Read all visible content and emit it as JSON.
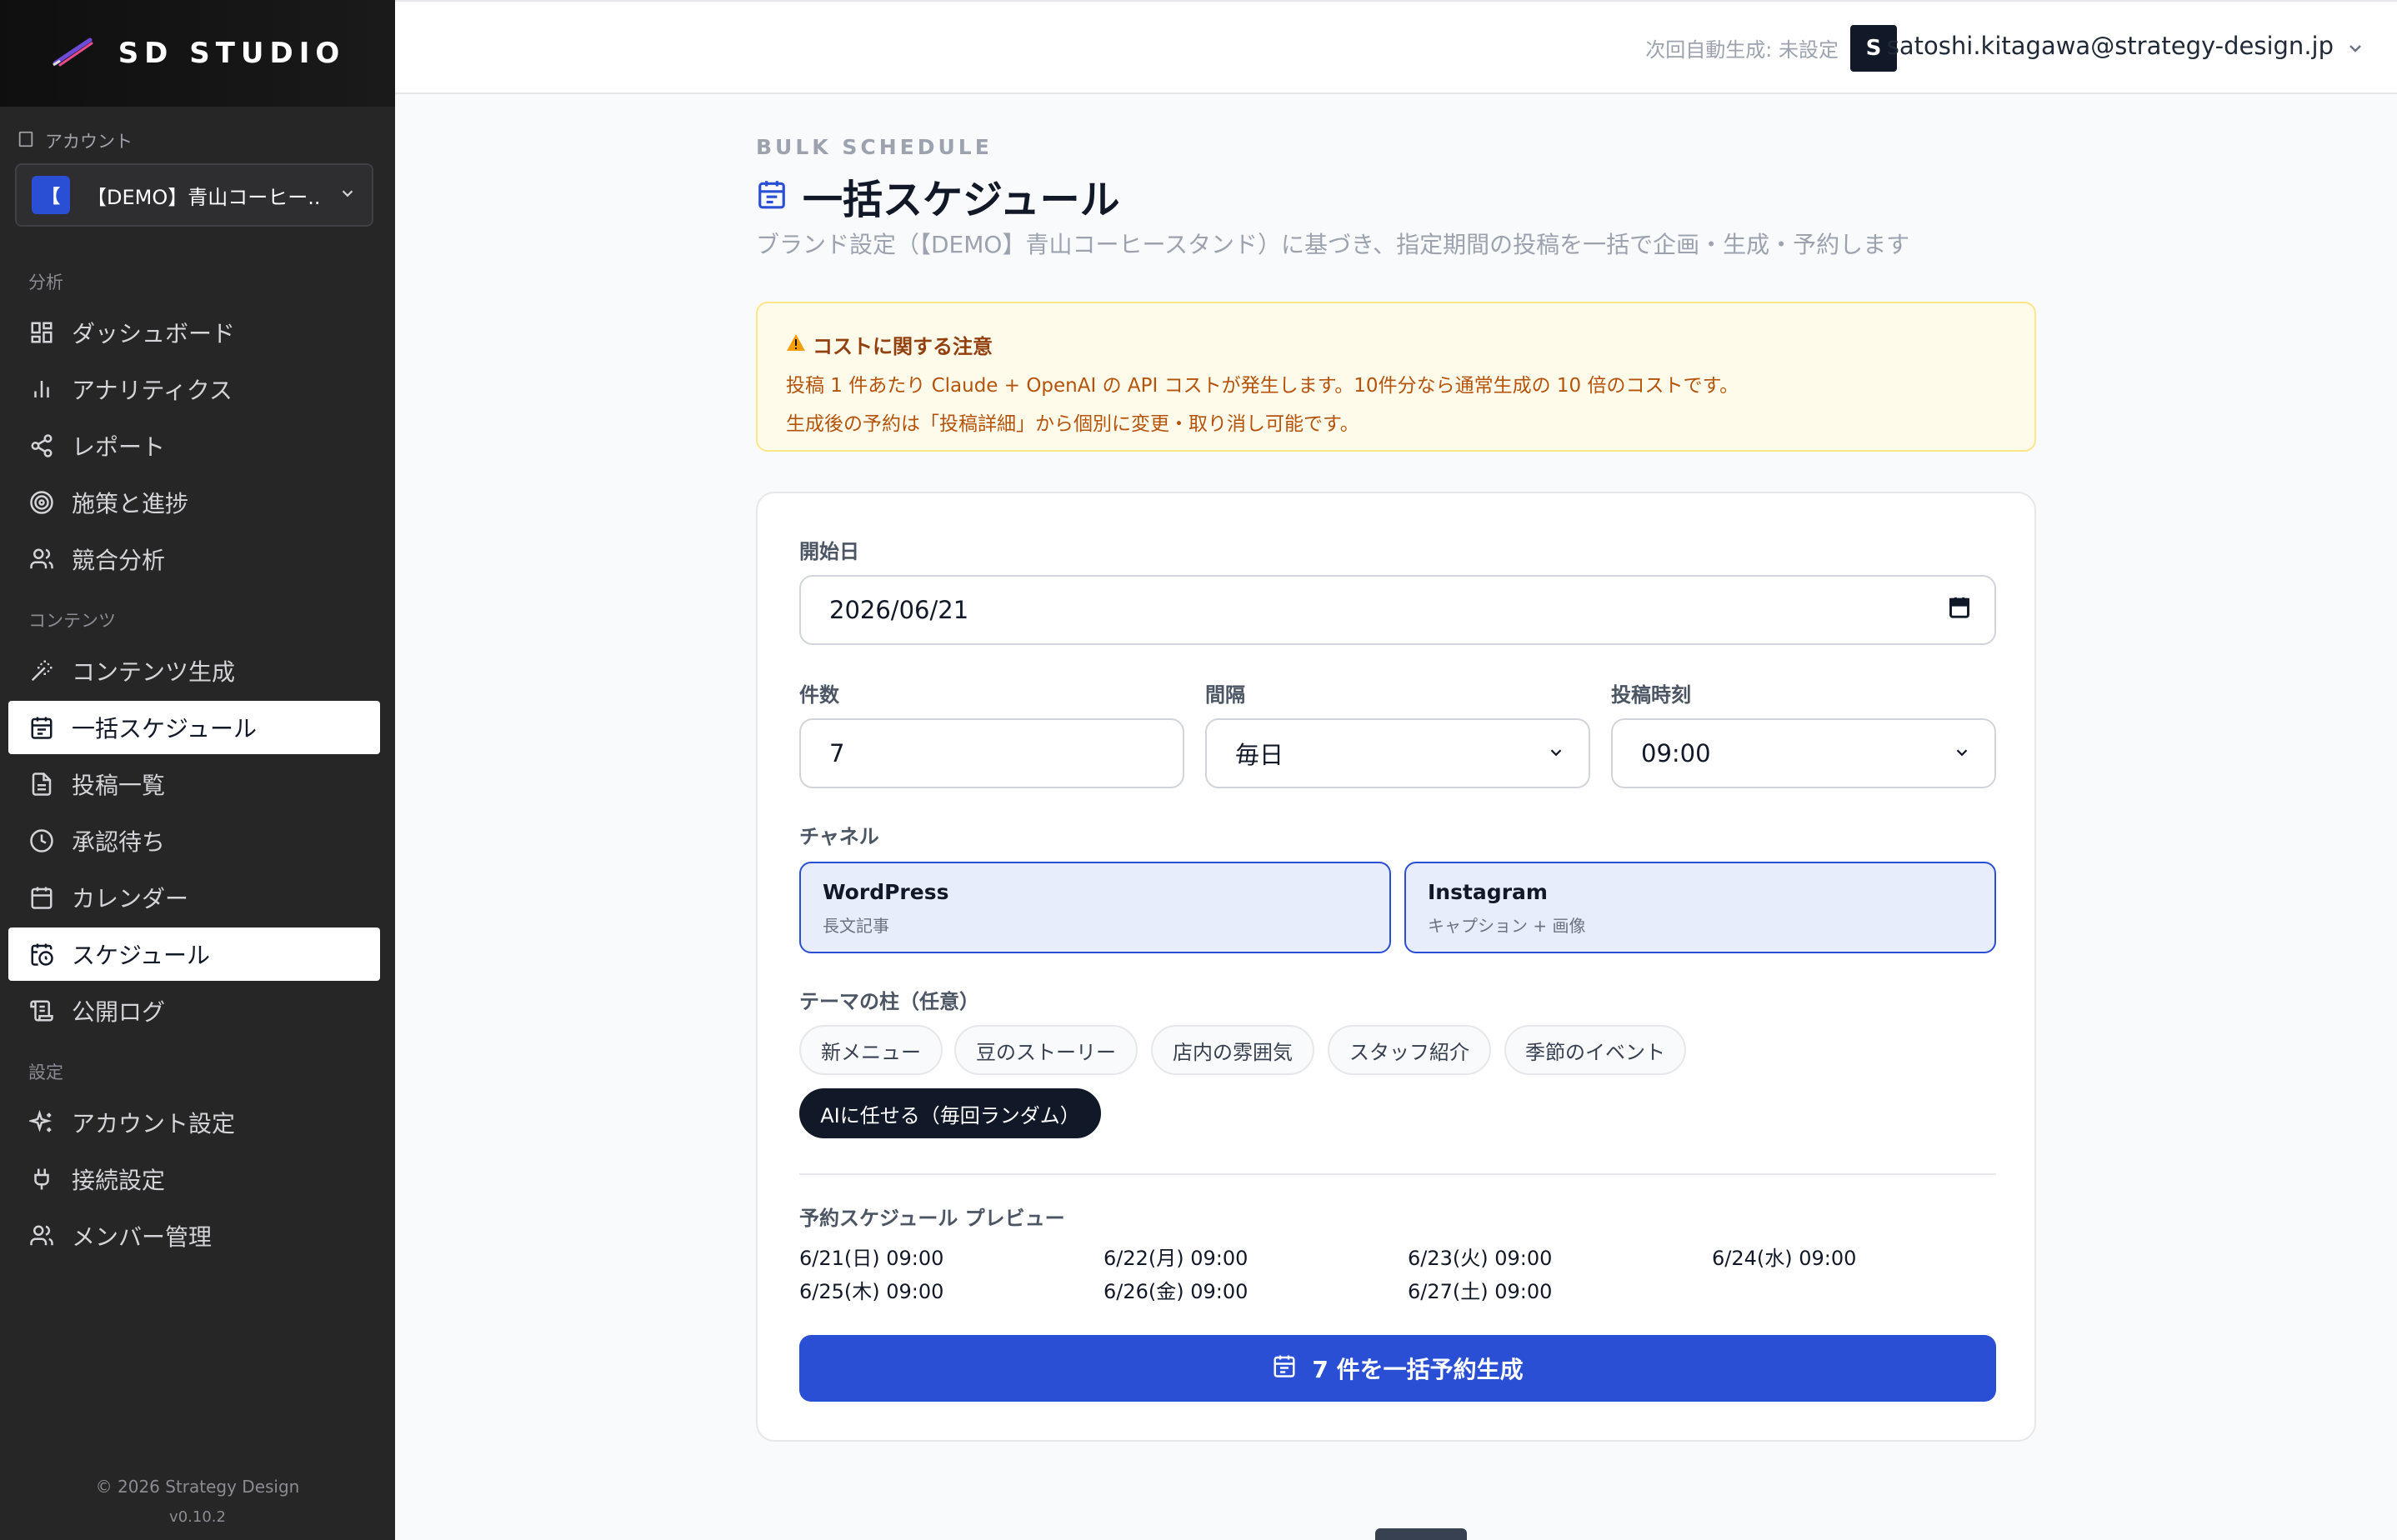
{
  "brand": {
    "name": "SD STUDIO"
  },
  "account": {
    "label": "アカウント",
    "badge": "【",
    "selected": "【DEMO】青山コーヒー..."
  },
  "sidebar": {
    "groups": [
      {
        "label": "分析",
        "items": [
          {
            "label": "ダッシュボード",
            "icon": "grid-icon"
          },
          {
            "label": "アナリティクス",
            "icon": "bar-chart-icon"
          },
          {
            "label": "レポート",
            "icon": "share-icon"
          },
          {
            "label": "施策と進捗",
            "icon": "target-icon"
          },
          {
            "label": "競合分析",
            "icon": "users-icon"
          }
        ]
      },
      {
        "label": "コンテンツ",
        "items": [
          {
            "label": "コンテンツ生成",
            "icon": "magic-wand-icon"
          },
          {
            "label": "一括スケジュール",
            "icon": "calendar-icon"
          },
          {
            "label": "投稿一覧",
            "icon": "document-icon"
          },
          {
            "label": "承認待ち",
            "icon": "clock-icon"
          },
          {
            "label": "カレンダー",
            "icon": "calendar-icon"
          },
          {
            "label": "スケジュール",
            "icon": "calendar-clock-icon"
          },
          {
            "label": "公開ログ",
            "icon": "scroll-icon"
          }
        ]
      },
      {
        "label": "設定",
        "items": [
          {
            "label": "アカウント設定",
            "icon": "sparkles-icon"
          },
          {
            "label": "接続設定",
            "icon": "plug-icon"
          },
          {
            "label": "メンバー管理",
            "icon": "users-icon"
          }
        ]
      }
    ],
    "footer": {
      "copyright": "© 2026 Strategy Design",
      "version": "v0.10.2"
    }
  },
  "header": {
    "auto_gen": "次回自動生成: 未設定",
    "avatar": "S",
    "email": "satoshi.kitagawa@strategy-design.jp"
  },
  "page": {
    "eyebrow": "BULK SCHEDULE",
    "title": "一括スケジュール",
    "subtitle": "ブランド設定（【DEMO】青山コーヒースタンド）に基づき、指定期間の投稿を一括で企画・生成・予約します"
  },
  "notice": {
    "title": "コストに関する注意",
    "line1": "投稿 1 件あたり Claude + OpenAI の API コストが発生します。10件分なら通常生成の 10 倍のコストです。",
    "line2": "生成後の予約は「投稿詳細」から個別に変更・取り消し可能です。"
  },
  "form": {
    "start_date_label": "開始日",
    "start_date": "2026/06/21",
    "count_label": "件数",
    "count": "7",
    "interval_label": "間隔",
    "interval": "毎日",
    "time_label": "投稿時刻",
    "time": "09:00",
    "channel_label": "チャネル",
    "channels": [
      {
        "name": "WordPress",
        "desc": "長文記事"
      },
      {
        "name": "Instagram",
        "desc": "キャプション + 画像"
      }
    ],
    "theme_label": "テーマの柱（任意）",
    "themes": [
      "新メニュー",
      "豆のストーリー",
      "店内の雰囲気",
      "スタッフ紹介",
      "季節のイベント"
    ],
    "ai_theme": "AIに任せる（毎回ランダム）",
    "preview_label": "予約スケジュール プレビュー",
    "preview": [
      "6/21(日) 09:00",
      "6/22(月) 09:00",
      "6/23(火) 09:00",
      "6/24(水) 09:00",
      "6/25(木) 09:00",
      "6/26(金) 09:00",
      "6/27(土) 09:00"
    ],
    "submit": "7 件を一括予約生成"
  }
}
